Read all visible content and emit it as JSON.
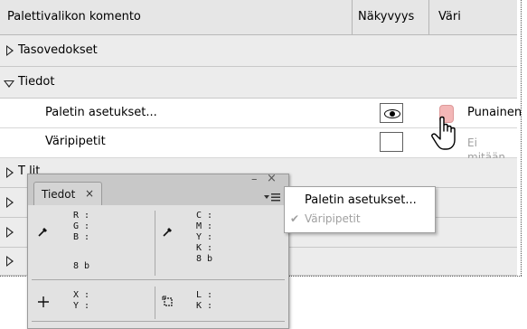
{
  "header": {
    "col_command": "Palettivalikon komento",
    "col_visibility": "Näkyvyys",
    "col_color": "Väri"
  },
  "rows": {
    "tasovedokset": "Tasovedokset",
    "tiedot": "Tiedot",
    "paletin_asetukset": "Paletin asetukset...",
    "varipipetit": "Väripipetit",
    "punainen": "Punainen",
    "ei_mitaan": "Ei mitään",
    "partial_row": "T     lit"
  },
  "panel": {
    "tab_label": "Tiedot",
    "tab_close": "×",
    "minimize": "–",
    "close": "×",
    "rgb": {
      "r": "R :",
      "g": "G :",
      "b": "B :",
      "bits": "8 b"
    },
    "cmyk": {
      "c": "C :",
      "m": "M :",
      "y": "Y :",
      "k": "K :",
      "bits": "8 b"
    },
    "xy": {
      "x": "X :",
      "y": "Y :"
    },
    "lk": {
      "l": "L :",
      "k": "K :"
    }
  },
  "menu": {
    "item1": "Paletin asetukset...",
    "item2": "Väripipetit",
    "check": "✔"
  },
  "colors": {
    "swatch_red": "#f3b7b7",
    "disabled_text": "#a0a0a0"
  }
}
